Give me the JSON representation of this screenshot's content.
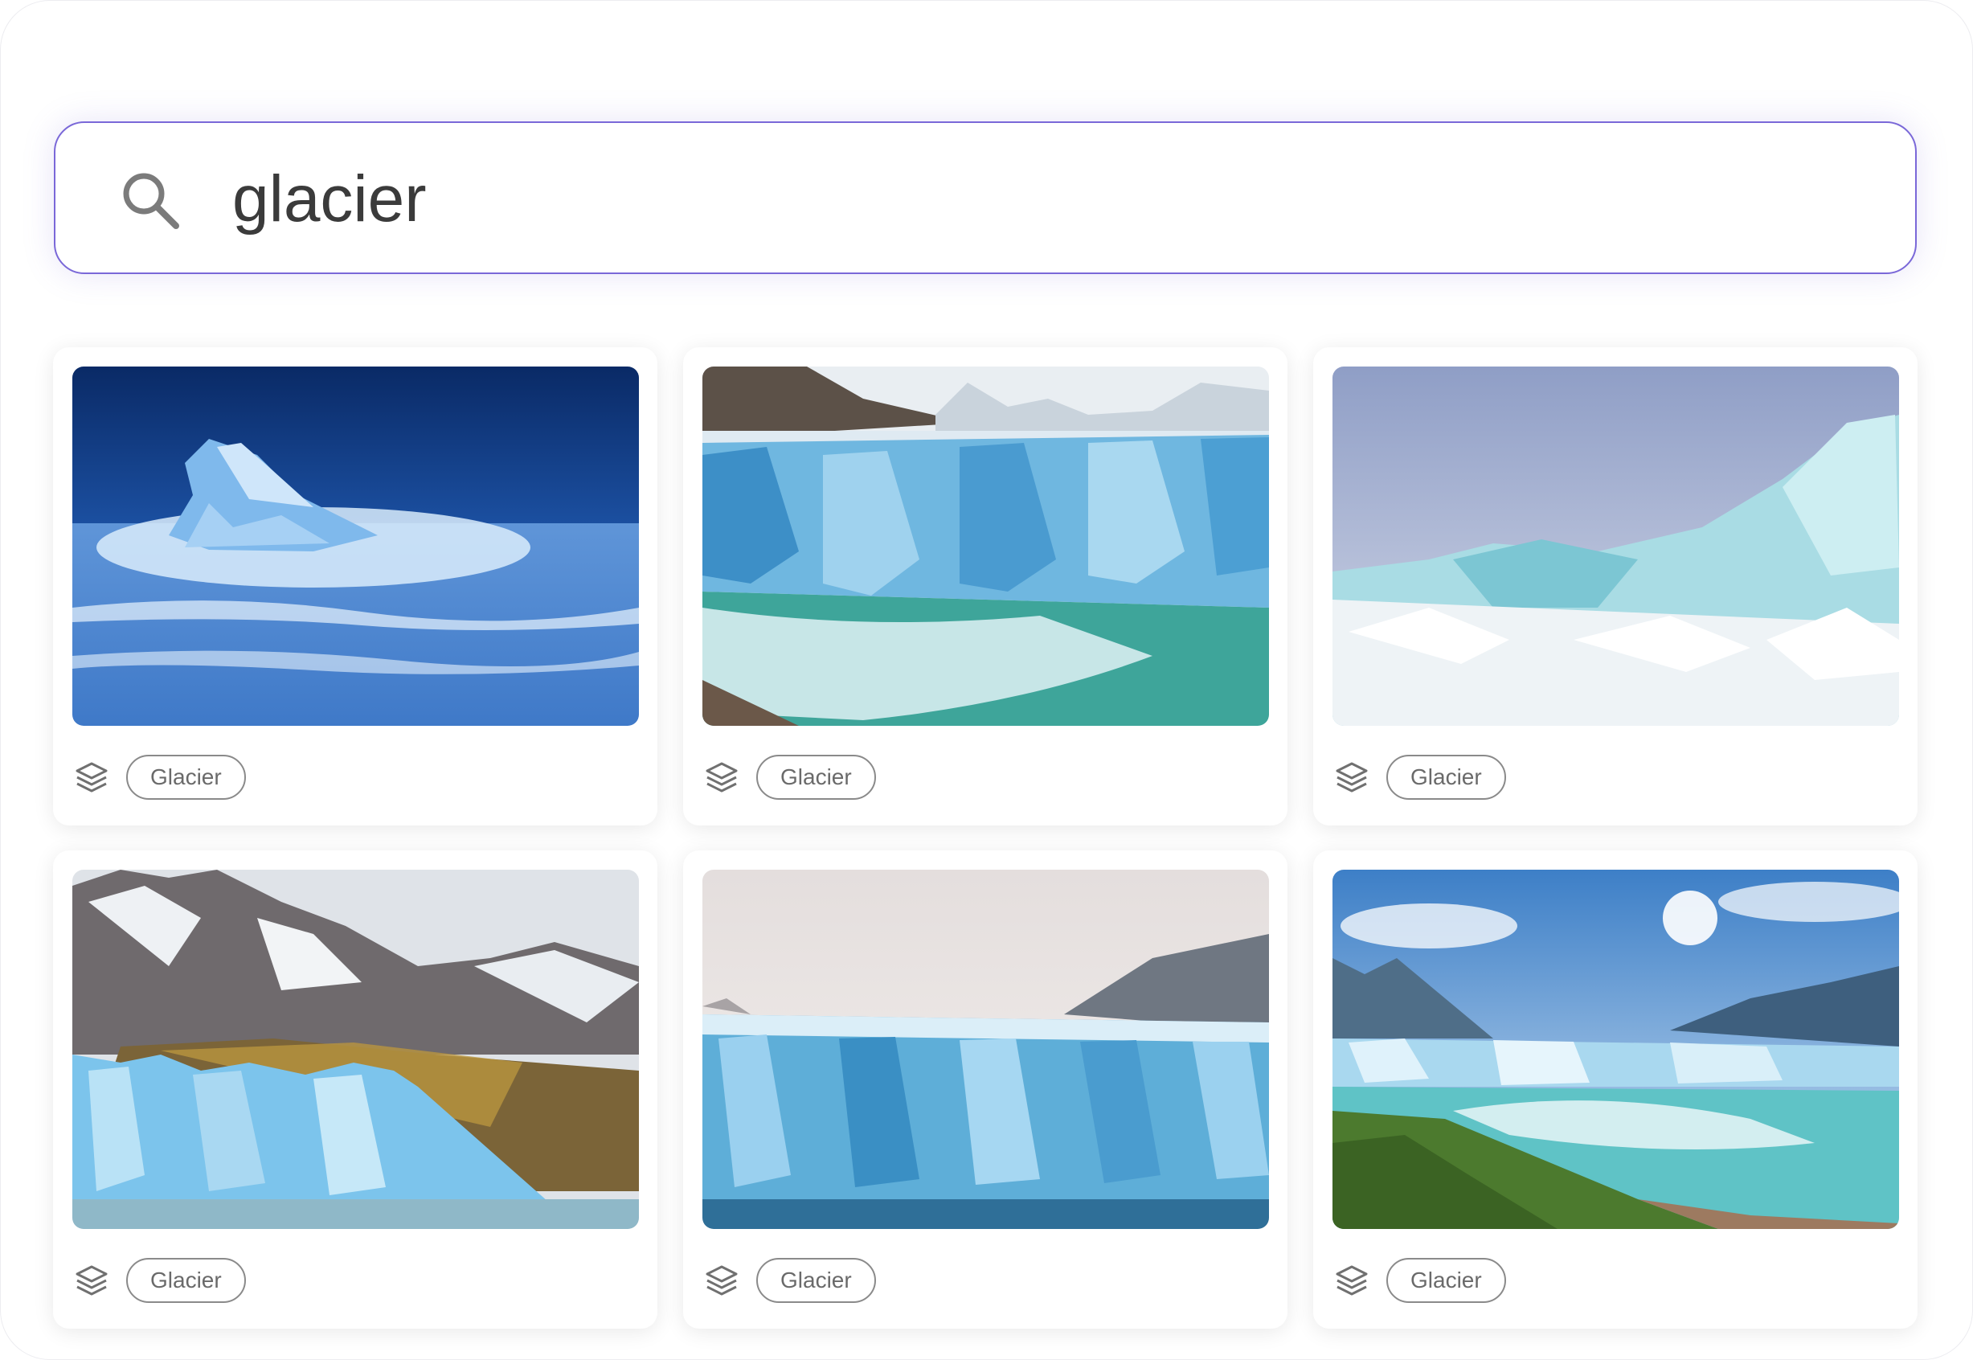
{
  "search": {
    "value": "glacier",
    "icon": "search-icon"
  },
  "results": [
    {
      "tag": "Glacier",
      "icon": "layers-icon"
    },
    {
      "tag": "Glacier",
      "icon": "layers-icon"
    },
    {
      "tag": "Glacier",
      "icon": "layers-icon"
    },
    {
      "tag": "Glacier",
      "icon": "layers-icon"
    },
    {
      "tag": "Glacier",
      "icon": "layers-icon"
    },
    {
      "tag": "Glacier",
      "icon": "layers-icon"
    }
  ],
  "colors": {
    "accent": "#7a68d8",
    "text": "#3b3b3b",
    "tag_border": "#8a8a8a"
  }
}
